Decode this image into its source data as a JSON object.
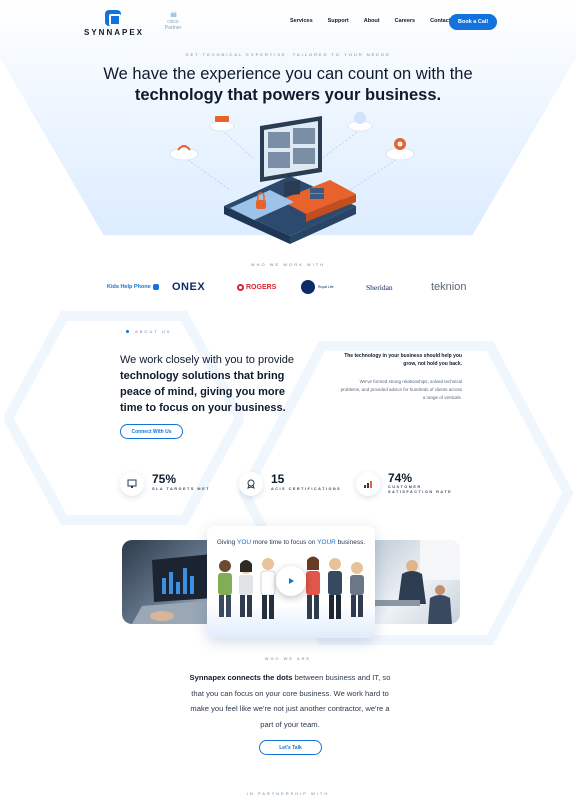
{
  "header": {
    "logo_text": "SYNNAPEX",
    "partner_badge": {
      "brand": "cisco",
      "text": "Partner"
    },
    "nav": [
      "Services",
      "Support",
      "About",
      "Careers",
      "Contact"
    ],
    "cta": "Book a Call"
  },
  "hero": {
    "kicker": "GET TECHNICAL EXPERTISE, TAILORED TO YOUR NEEDS",
    "line1": "We have the experience you can count on with the",
    "line2": "technology that powers your business."
  },
  "clients": {
    "label": "WHO WE WORK WITH",
    "logos": [
      "Kids Help Phone",
      "ONEX",
      "ROGERS",
      "Royal Life",
      "Sheridan",
      "teknion"
    ]
  },
  "about": {
    "label": "ABOUT US",
    "head_plain": "We work closely with you to provide ",
    "head_bold": "technology solutions that bring peace of mind, giving you more time to focus on your business.",
    "right_head": "The technology in your business should help you grow, not hold you back.",
    "right_body": "We've formed strong relationships, solved technical problems, and provided advice for hundreds of clients across a range of verticals.",
    "cta": "Connect With Us"
  },
  "stats": [
    {
      "value": "75%",
      "label": "SLA TARGETS MET",
      "icon": "monitor-icon"
    },
    {
      "value": "15",
      "label": "ACIS CERTIFICATIONS",
      "icon": "certificate-icon"
    },
    {
      "value": "74%",
      "label": "CUSTOMER SATISFACTION RATE",
      "icon": "chart-icon"
    }
  ],
  "video": {
    "title_a": "Giving ",
    "title_you": "YOU",
    "title_b": " more time to focus on ",
    "title_your": "YOUR",
    "title_c": " business."
  },
  "who": {
    "label": "WHO WE ARE",
    "bold": "Synnapex connects the dots",
    "text": " between business and IT, so that you can focus on your core business. We work hard to make you feel like we're not just another contractor, we're a part of your team.",
    "cta": "Let's Talk"
  },
  "partner_label": "IN PARTNERSHIP WITH",
  "colors": {
    "accent": "#1273de",
    "dark": "#0f1b2d",
    "orange": "#e8622c"
  }
}
